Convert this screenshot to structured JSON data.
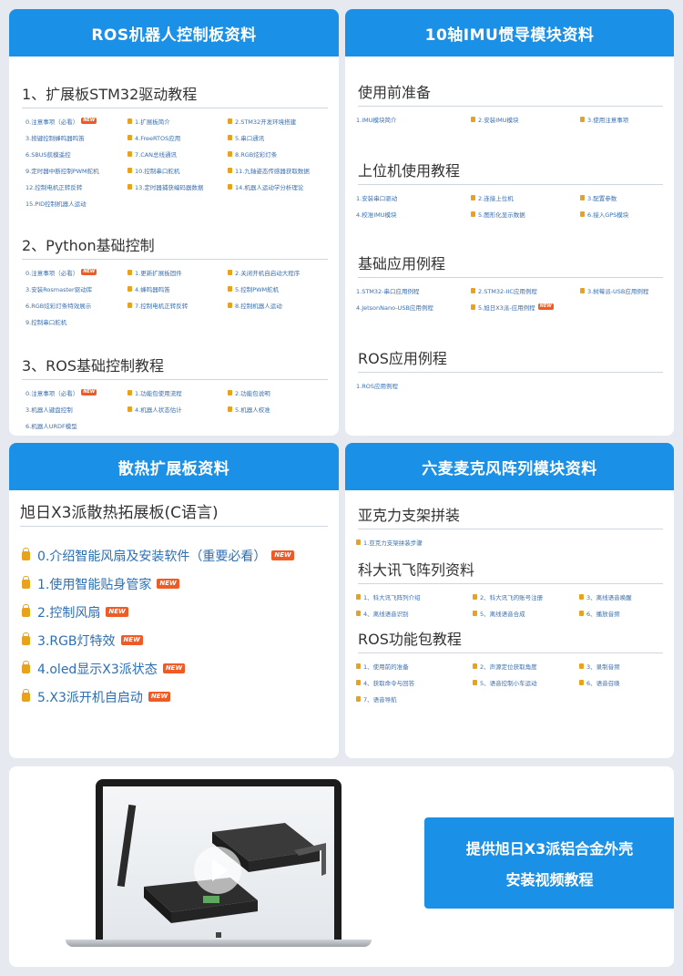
{
  "ros": {
    "header": "ROS机器人控制板资料",
    "sections": [
      {
        "title": "1、扩展板STM32驱动教程",
        "items": [
          {
            "label": "0.注意事项（必看）",
            "new": true
          },
          {
            "label": "1.扩展板简介"
          },
          {
            "label": "2.STM32开发环境搭建"
          },
          {
            "label": "3.按键控制蜂鸣器鸣笛"
          },
          {
            "label": "4.FreeRTOS应用"
          },
          {
            "label": "5.串口通讯"
          },
          {
            "label": "6.SBUS航模遥控"
          },
          {
            "label": "7.CAN总线通讯"
          },
          {
            "label": "8.RGB炫彩灯条"
          },
          {
            "label": "9.定时器中断控制PWM舵机"
          },
          {
            "label": "10.控制串口舵机"
          },
          {
            "label": "11.九轴姿态传感器获取数据"
          },
          {
            "label": "12.控制电机正转反转"
          },
          {
            "label": "13.定时器捕获编码器数据"
          },
          {
            "label": "14.机器人运动学分析理论"
          },
          {
            "label": "15.PID控制机器人运动"
          }
        ]
      },
      {
        "title": "2、Python基础控制",
        "items": [
          {
            "label": "0.注意事项（必看）",
            "new": true
          },
          {
            "label": "1.更新扩展板固件"
          },
          {
            "label": "2.关闭开机自启动大程序"
          },
          {
            "label": "3.安装Rosmaster驱动库"
          },
          {
            "label": "4.蜂鸣器鸣笛"
          },
          {
            "label": "5.控制PWM舵机"
          },
          {
            "label": "6.RGB炫彩灯条特效展示"
          },
          {
            "label": "7.控制电机正转反转"
          },
          {
            "label": "8.控制机器人运动"
          },
          {
            "label": "9.控制串口舵机"
          }
        ]
      },
      {
        "title": "3、ROS基础控制教程",
        "items": [
          {
            "label": "0.注意事项（必看）",
            "new": true
          },
          {
            "label": "1.功能包使用流程"
          },
          {
            "label": "2.功能包说明"
          },
          {
            "label": "3.机器人键盘控制"
          },
          {
            "label": "4.机器人状态估计"
          },
          {
            "label": "5.机器人校准"
          },
          {
            "label": "6.机器人URDF模型"
          }
        ]
      }
    ]
  },
  "imu": {
    "header": "10轴IMU惯导模块资料",
    "sections": [
      {
        "title": "使用前准备",
        "items": [
          {
            "label": "1.IMU模块简介"
          },
          {
            "label": "2.安装IMU模块"
          },
          {
            "label": "3.使用注意事项"
          }
        ]
      },
      {
        "title": "上位机使用教程",
        "items": [
          {
            "label": "1.安装串口驱动"
          },
          {
            "label": "2.连接上位机"
          },
          {
            "label": "3.配置参数"
          },
          {
            "label": "4.校准IMU模块"
          },
          {
            "label": "5.图形化显示数据"
          },
          {
            "label": "6.接入GPS模块"
          }
        ]
      },
      {
        "title": "基础应用例程",
        "items": [
          {
            "label": "1.STM32-串口应用例程"
          },
          {
            "label": "2.STM32-IIC应用例程"
          },
          {
            "label": "3.树莓派-USB应用例程"
          },
          {
            "label": "4.JetsonNano-USB应用例程"
          },
          {
            "label": "5.旭日X3派-应用例程",
            "new": true
          }
        ]
      },
      {
        "title": "ROS应用例程",
        "items": [
          {
            "label": "1.ROS应用例程"
          }
        ]
      }
    ]
  },
  "heat": {
    "header": "散热扩展板资料",
    "subtitle": "旭日X3派散热拓展板(C语言)",
    "items": [
      {
        "label": "0.介绍智能风扇及安装软件（重要必看）",
        "new": true
      },
      {
        "label": "1.使用智能贴身管家",
        "new": true
      },
      {
        "label": "2.控制风扇",
        "new": true
      },
      {
        "label": "3.RGB灯特效",
        "new": true
      },
      {
        "label": "4.oled显示X3派状态",
        "new": true
      },
      {
        "label": "5.X3派开机自启动",
        "new": true
      }
    ]
  },
  "mic": {
    "header": "六麦麦克风阵列模块资料",
    "sections": [
      {
        "title": "亚克力支架拼装",
        "items": [
          {
            "label": "1.亚克力支架拼装步骤"
          }
        ]
      },
      {
        "title": "科大讯飞阵列资料",
        "items": [
          {
            "label": "1、科大讯飞阵列介绍"
          },
          {
            "label": "2、科大讯飞的账号注册"
          },
          {
            "label": "3、离线语音唤醒"
          },
          {
            "label": "4、离线语音识别"
          },
          {
            "label": "5、离线语音合成"
          },
          {
            "label": "6、播放音频"
          }
        ]
      },
      {
        "title": "ROS功能包教程",
        "items": [
          {
            "label": "1、使用前的准备"
          },
          {
            "label": "2、声源定位获取角度"
          },
          {
            "label": "3、录制音频"
          },
          {
            "label": "4、获取命令与回答"
          },
          {
            "label": "5、语音控制小车运动"
          },
          {
            "label": "6、语音召唤"
          },
          {
            "label": "7、语音导航"
          }
        ]
      }
    ]
  },
  "new_badge": "NEW",
  "promo": {
    "line1": "提供旭日X3派铝合金外壳",
    "line2": "安装视频教程"
  },
  "colors": {
    "accent": "#1a90e6",
    "link": "#3a6fb0",
    "badge": "#f05a24",
    "icon": "#e9a21c"
  }
}
